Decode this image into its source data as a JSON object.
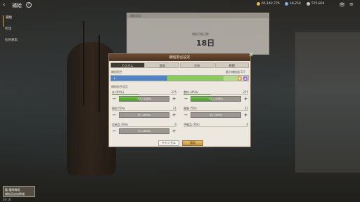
{
  "header": {
    "back_glyph": "‹",
    "title": "補給",
    "help_glyph": "?",
    "resources": [
      {
        "value": "65,142,776",
        "color": "#e0b84a",
        "icon": "gold-coin-icon"
      },
      {
        "value": "18,250",
        "color": "#7ab0e0",
        "icon": "gem-icon"
      },
      {
        "value": "575,824",
        "color": "#c8c8c8",
        "icon": "silver-icon"
      }
    ],
    "eye_glyph": "👁",
    "menu_glyph": "≡"
  },
  "side_menu": [
    "補給",
    "修理",
    "船員募集"
  ],
  "background_panel": {
    "header": "補給状況",
    "days_label": "補給可能日数",
    "days": "18日"
  },
  "dialog": {
    "title": "補給割合設定",
    "close_glyph": "✕",
    "tabs": [
      "カスタム",
      "冒険",
      "交易",
      "戦闘"
    ],
    "active_tab": 0,
    "ratio_label": "補給割合",
    "max_label": "最大補給量 5/7",
    "ratio_segments": [
      {
        "label": "水",
        "fraction": 0.41,
        "color": "#4f84c8"
      },
      {
        "label": "食料",
        "fraction": 0.41,
        "color": "#8acb5a"
      },
      {
        "label": "other",
        "fraction": 0.12,
        "color": "#b7d88d"
      }
    ],
    "setting_label": "補給割合設定",
    "stats": [
      {
        "name": "水 (45%)",
        "value": "275",
        "fill": 0.42,
        "slider": "42 / 100%",
        "icon": "water-icon"
      },
      {
        "name": "食料 (45%)",
        "value": "275",
        "fill": 0.42,
        "slider": "42 / 100%",
        "icon": "food-icon"
      },
      {
        "name": "資材 (5%)",
        "value": "31",
        "fill": 0.0,
        "slider": "8 / 100%",
        "icon": "material-icon"
      },
      {
        "name": "弾薬 (5%)",
        "value": "31",
        "fill": 0.0,
        "slider": "8 / 100%",
        "icon": "ammo-icon"
      },
      {
        "name": "交易品 (0%)",
        "value": "0",
        "fill": 0.0,
        "slider": "0 / 100%",
        "icon": "trade-goods-icon"
      },
      {
        "name": "予備品 (0%)",
        "value": "0",
        "fill": 0.0,
        "slider": "0 / 100%",
        "icon": "spare-icon"
      }
    ],
    "cancel_label": "キャンセル",
    "apply_label": "適用"
  },
  "notice": {
    "line1": "艦 艦隊情報",
    "line2": "補給品追加情報"
  },
  "version": "20:10"
}
